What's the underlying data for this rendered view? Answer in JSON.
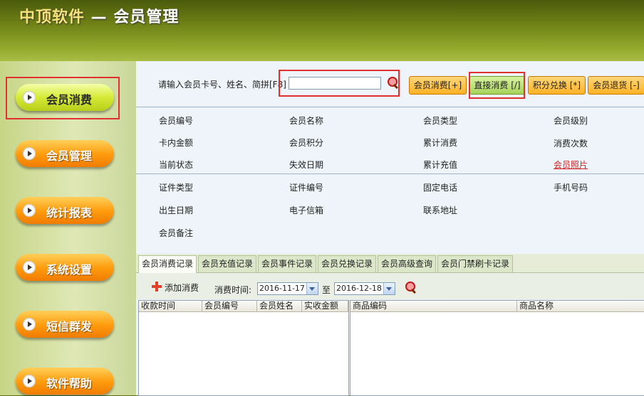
{
  "app": {
    "brand": "中顶软件",
    "title_suffix": " — 会员管理"
  },
  "sidebar": {
    "items": [
      {
        "label": "会员消费",
        "active": true
      },
      {
        "label": "会员管理"
      },
      {
        "label": "统计报表"
      },
      {
        "label": "系统设置"
      },
      {
        "label": "短信群发"
      },
      {
        "label": "软件帮助"
      }
    ]
  },
  "search": {
    "label": "请输入会员卡号、姓名、简拼[F8]",
    "value": "",
    "icon": "search-icon"
  },
  "actions": {
    "consume": "会员消费[+]",
    "direct": "直接消费 [/]",
    "redeem": "积分兑换 [*]",
    "refund": "会员退货 [-]"
  },
  "fields": {
    "member_no": "会员编号",
    "member_name": "会员名称",
    "member_type": "会员类型",
    "member_level": "会员级别",
    "card_balance": "卡内金额",
    "member_points": "会员积分",
    "total_consume": "累计消费",
    "consume_count": "消费次数",
    "status": "当前状态",
    "expire_date": "失效日期",
    "total_recharge": "累计充值",
    "photo": "会员照片",
    "id_type": "证件类型",
    "id_no": "证件编号",
    "phone": "固定电话",
    "mobile": "手机号码",
    "birthday": "出生日期",
    "email": "电子信箱",
    "address": "联系地址",
    "remark": "会员备注"
  },
  "tabs": [
    {
      "label": "会员消费记录",
      "active": true
    },
    {
      "label": "会员充值记录"
    },
    {
      "label": "会员事件记录"
    },
    {
      "label": "会员兑换记录"
    },
    {
      "label": "会员高级查询"
    },
    {
      "label": "会员门禁刷卡记录"
    }
  ],
  "toolbar": {
    "add_label": "添加消费",
    "time_label": "消费时间:",
    "start_date": "2016-11-17",
    "to_label": "至",
    "end_date": "2016-12-18"
  },
  "left_table": {
    "columns": [
      "收款时间",
      "会员编号",
      "会员姓名",
      "实收金额"
    ]
  },
  "right_table": {
    "columns": [
      "商品编码",
      "商品名称"
    ]
  },
  "colors": {
    "accent_orange": "#ff9e10",
    "accent_green": "#d5ea36",
    "highlight_red": "#e03030"
  }
}
